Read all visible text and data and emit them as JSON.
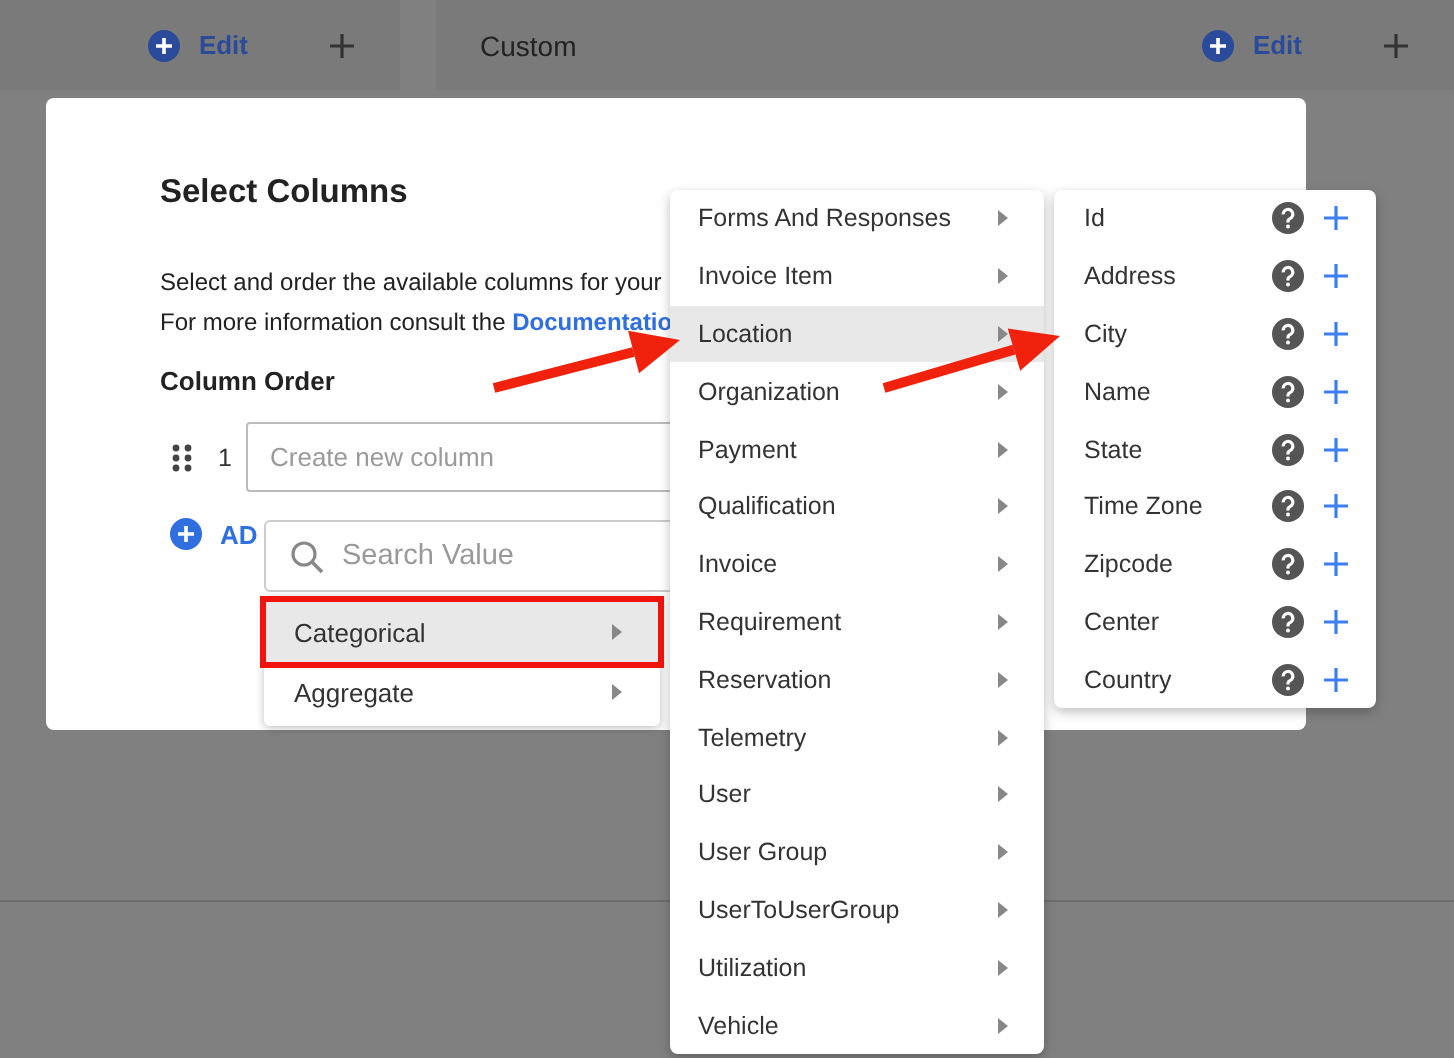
{
  "header_panels": [
    {
      "edit_label": "Edit"
    },
    {
      "title": "Custom",
      "edit_label": "Edit"
    }
  ],
  "dialog": {
    "title": "Select Columns",
    "description": "Select and order the available columns for your",
    "info_prefix": "For more information consult the",
    "info_link": "Documentatio",
    "column_order_label": "Column Order",
    "rows": [
      {
        "index": "1",
        "placeholder": "Create new column"
      }
    ],
    "add_label": "AD"
  },
  "type_menu": {
    "search_placeholder": "Search Value",
    "items": [
      {
        "label": "Categorical",
        "selected": true,
        "highlighted": true
      },
      {
        "label": "Aggregate",
        "selected": false,
        "highlighted": false
      }
    ]
  },
  "category_menu": {
    "items": [
      {
        "label": "Forms And Responses",
        "selected": false
      },
      {
        "label": "Invoice Item",
        "selected": false
      },
      {
        "label": "Location",
        "selected": true
      },
      {
        "label": "Organization",
        "selected": false
      },
      {
        "label": "Payment",
        "selected": false
      },
      {
        "label": "Qualification",
        "selected": false
      },
      {
        "label": "Invoice",
        "selected": false
      },
      {
        "label": "Requirement",
        "selected": false
      },
      {
        "label": "Reservation",
        "selected": false
      },
      {
        "label": "Telemetry",
        "selected": false
      },
      {
        "label": "User",
        "selected": false
      },
      {
        "label": "User Group",
        "selected": false
      },
      {
        "label": "UserToUserGroup",
        "selected": false
      },
      {
        "label": "Utilization",
        "selected": false
      },
      {
        "label": "Vehicle",
        "selected": false
      }
    ]
  },
  "field_menu": {
    "items": [
      {
        "label": "Id"
      },
      {
        "label": "Address"
      },
      {
        "label": "City"
      },
      {
        "label": "Name"
      },
      {
        "label": "State"
      },
      {
        "label": "Time Zone"
      },
      {
        "label": "Zipcode"
      },
      {
        "label": "Center"
      },
      {
        "label": "Country"
      }
    ]
  },
  "annotations": [
    {
      "kind": "arrow"
    },
    {
      "kind": "arrow"
    }
  ]
}
